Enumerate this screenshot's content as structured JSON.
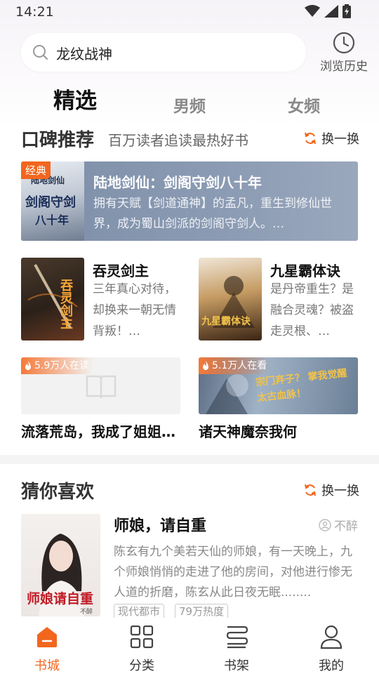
{
  "status_bar": {
    "time": "14:21"
  },
  "search": {
    "text": "龙纹战神"
  },
  "history": {
    "label": "浏览历史"
  },
  "tabs": [
    {
      "label": "精选",
      "active": true
    },
    {
      "label": "男频",
      "active": false
    },
    {
      "label": "女频",
      "active": false
    }
  ],
  "recommend": {
    "title": "口碑推荐",
    "subtitle": "百万读者追读最热好书",
    "refresh_label": "换一换",
    "featured": {
      "badge": "经典",
      "title": "陆地剑仙：剑阁守剑八十年",
      "desc": "拥有天赋【剑道通神】的孟凡，重生到修仙世界，成为蜀山剑派的剑阁守剑人。…",
      "cover_text_main": "剑阁守剑",
      "cover_text_sub": "八十年",
      "cover_text_top": "陆地剑仙"
    },
    "books": [
      {
        "title": "吞灵剑主",
        "desc": "三年真心对待，却换来一朝无情背叛！…",
        "cover_text": "吞灵剑主"
      },
      {
        "title": "九星霸体诀",
        "desc": "是丹帝重生？是融合灵魂？被盗走灵根、…",
        "cover_text": "九星霸体诀"
      }
    ],
    "wide_books": [
      {
        "title": "流落荒岛，我成了姐姐…",
        "hot": "5.9万人在读"
      },
      {
        "title": "诸天神魔奈我何",
        "hot": "5.1万人在看",
        "cover_text": "宗门弃子？ 掌我觉醒太古血脉！"
      }
    ]
  },
  "guess": {
    "title": "猜你喜欢",
    "refresh_label": "换一换",
    "book": {
      "title": "师娘，请自重",
      "author": "不醉",
      "desc": "陈玄有九个美若天仙的师娘，有一天晚上，九个师娘悄悄的走进了他的房间，对他进行惨无人道的折磨，陈玄从此日夜无眠........",
      "tags": [
        "现代都市",
        "79万热度"
      ],
      "cover_text": "师娘请自重",
      "cover_author": "不醉"
    }
  },
  "bottom_nav": [
    {
      "label": "书城",
      "icon": "home-icon",
      "active": true
    },
    {
      "label": "分类",
      "icon": "grid-icon",
      "active": false
    },
    {
      "label": "书架",
      "icon": "bookshelf-icon",
      "active": false
    },
    {
      "label": "我的",
      "icon": "person-icon",
      "active": false
    }
  ],
  "colors": {
    "accent": "#f2661e",
    "banner": "#7d8ea8"
  }
}
